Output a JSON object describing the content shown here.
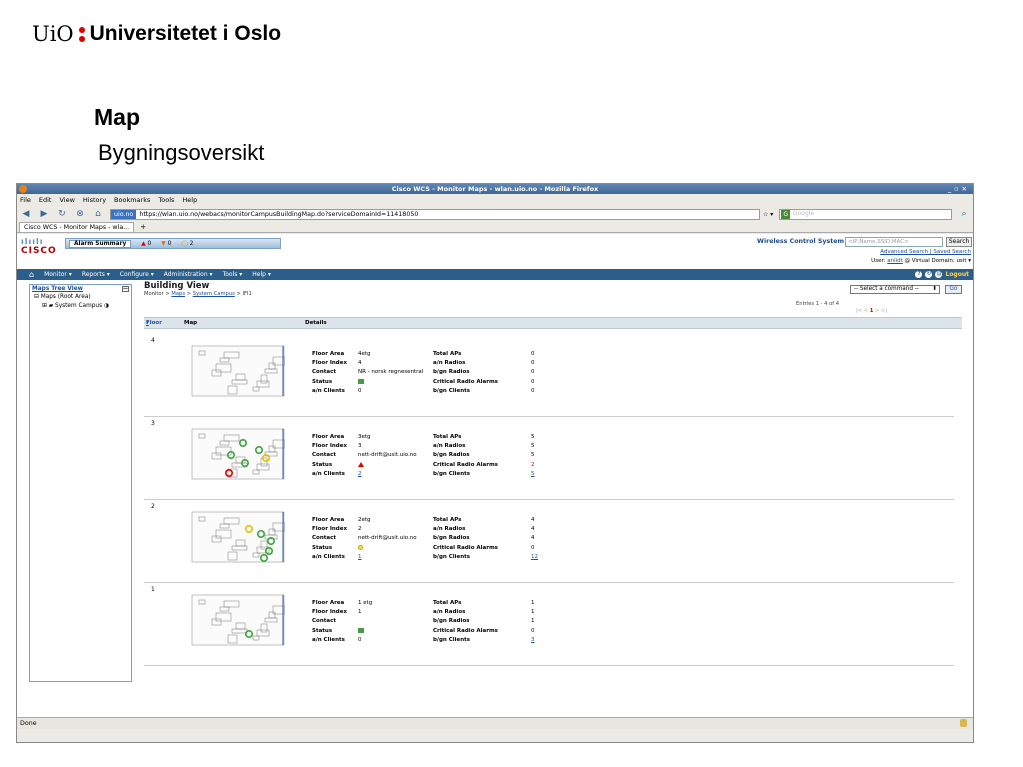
{
  "slide": {
    "logo_short": "UiO",
    "logo_name": "Universitetet i Oslo",
    "title": "Map",
    "subtitle": "Bygningsoversikt"
  },
  "browser": {
    "window_title": "Cisco WCS - Monitor Maps - wlan.uio.no - Mozilla Firefox",
    "menu": [
      "File",
      "Edit",
      "View",
      "History",
      "Bookmarks",
      "Tools",
      "Help"
    ],
    "url_identity": "uio.no",
    "url": "https://wlan.uio.no/webacs/monitorCampusBuildingMap.do?serviceDomainId=11418050",
    "search_engine": "G",
    "search_placeholder": "Google",
    "tab_label": "Cisco WCS - Monitor Maps - wla...",
    "new_tab": "+",
    "status_text": "Done"
  },
  "wcs": {
    "logo_bars": "ılıılı",
    "logo_word": "CISCO",
    "alarm_summary_label": "Alarm Summary",
    "alarm_critical": "0",
    "alarm_major": "0",
    "alarm_minor": "2",
    "product_label": "Wireless Control System",
    "search_placeholder": "<IP,Name,SSID,MAC>",
    "search_button": "Search",
    "advanced_search": "Advanced Search | Saved Search",
    "user_prefix": "User:",
    "user_name": "anlidt",
    "virtual_domain": "@ Virtual Domain: usit",
    "nav": [
      "Monitor ▾",
      "Reports ▾",
      "Configure ▾",
      "Administration ▾",
      "Tools ▾",
      "Help ▾"
    ],
    "logout": "Logout"
  },
  "tree": {
    "header": "Maps Tree View",
    "root": "Maps (Root Area)",
    "child": "System Campus"
  },
  "building_view": {
    "title": "Building View",
    "crumb_prefix": "Monitor >",
    "crumb_maps": "Maps",
    "crumb_sep": ">",
    "crumb_campus": "System Campus",
    "crumb_end": "> IFI1",
    "command_select": "-- Select a command --",
    "go_button": "Go",
    "entries": "Entries 1 - 4 of 4",
    "pager": "|< < ",
    "pager_current": "1",
    "pager_tail": " > >|",
    "col_floor": "Floor",
    "col_map": "Map",
    "col_details": "Details"
  },
  "detail_labels": {
    "floor_area": "Floor Area",
    "floor_index": "Floor Index",
    "contact": "Contact",
    "status": "Status",
    "an_clients": "a/n Clients",
    "total_aps": "Total APs",
    "an_radios": "a/n Radios",
    "bgn_radios": "b/gn Radios",
    "critical_radio_alarms": "Critical Radio Alarms",
    "bgn_clients": "b/gn Clients"
  },
  "floors": [
    {
      "floor": "4",
      "floor_area": "4etg",
      "floor_index": "4",
      "contact": "NR - norsk regnesentral",
      "status": "ok",
      "an_clients": "0",
      "total_aps": "0",
      "an_radios": "0",
      "bgn_radios": "0",
      "critical_radio_alarms": "0",
      "bgn_clients": "0"
    },
    {
      "floor": "3",
      "floor_area": "3etg",
      "floor_index": "3",
      "contact": "nett-drift@usit.uio.no",
      "status": "critical",
      "an_clients": "2",
      "total_aps": "5",
      "an_radios": "5",
      "bgn_radios": "5",
      "critical_radio_alarms": "2",
      "bgn_clients": "5"
    },
    {
      "floor": "2",
      "floor_area": "2etg",
      "floor_index": "2",
      "contact": "nett-drift@usit.uio.no",
      "status": "minor",
      "an_clients": "1",
      "total_aps": "4",
      "an_radios": "4",
      "bgn_radios": "4",
      "critical_radio_alarms": "0",
      "bgn_clients": "12"
    },
    {
      "floor": "1",
      "floor_area": "1 etg",
      "floor_index": "1",
      "contact": "",
      "status": "ok",
      "an_clients": "0",
      "total_aps": "1",
      "an_radios": "1",
      "bgn_radios": "1",
      "critical_radio_alarms": "0",
      "bgn_clients": "3"
    }
  ]
}
